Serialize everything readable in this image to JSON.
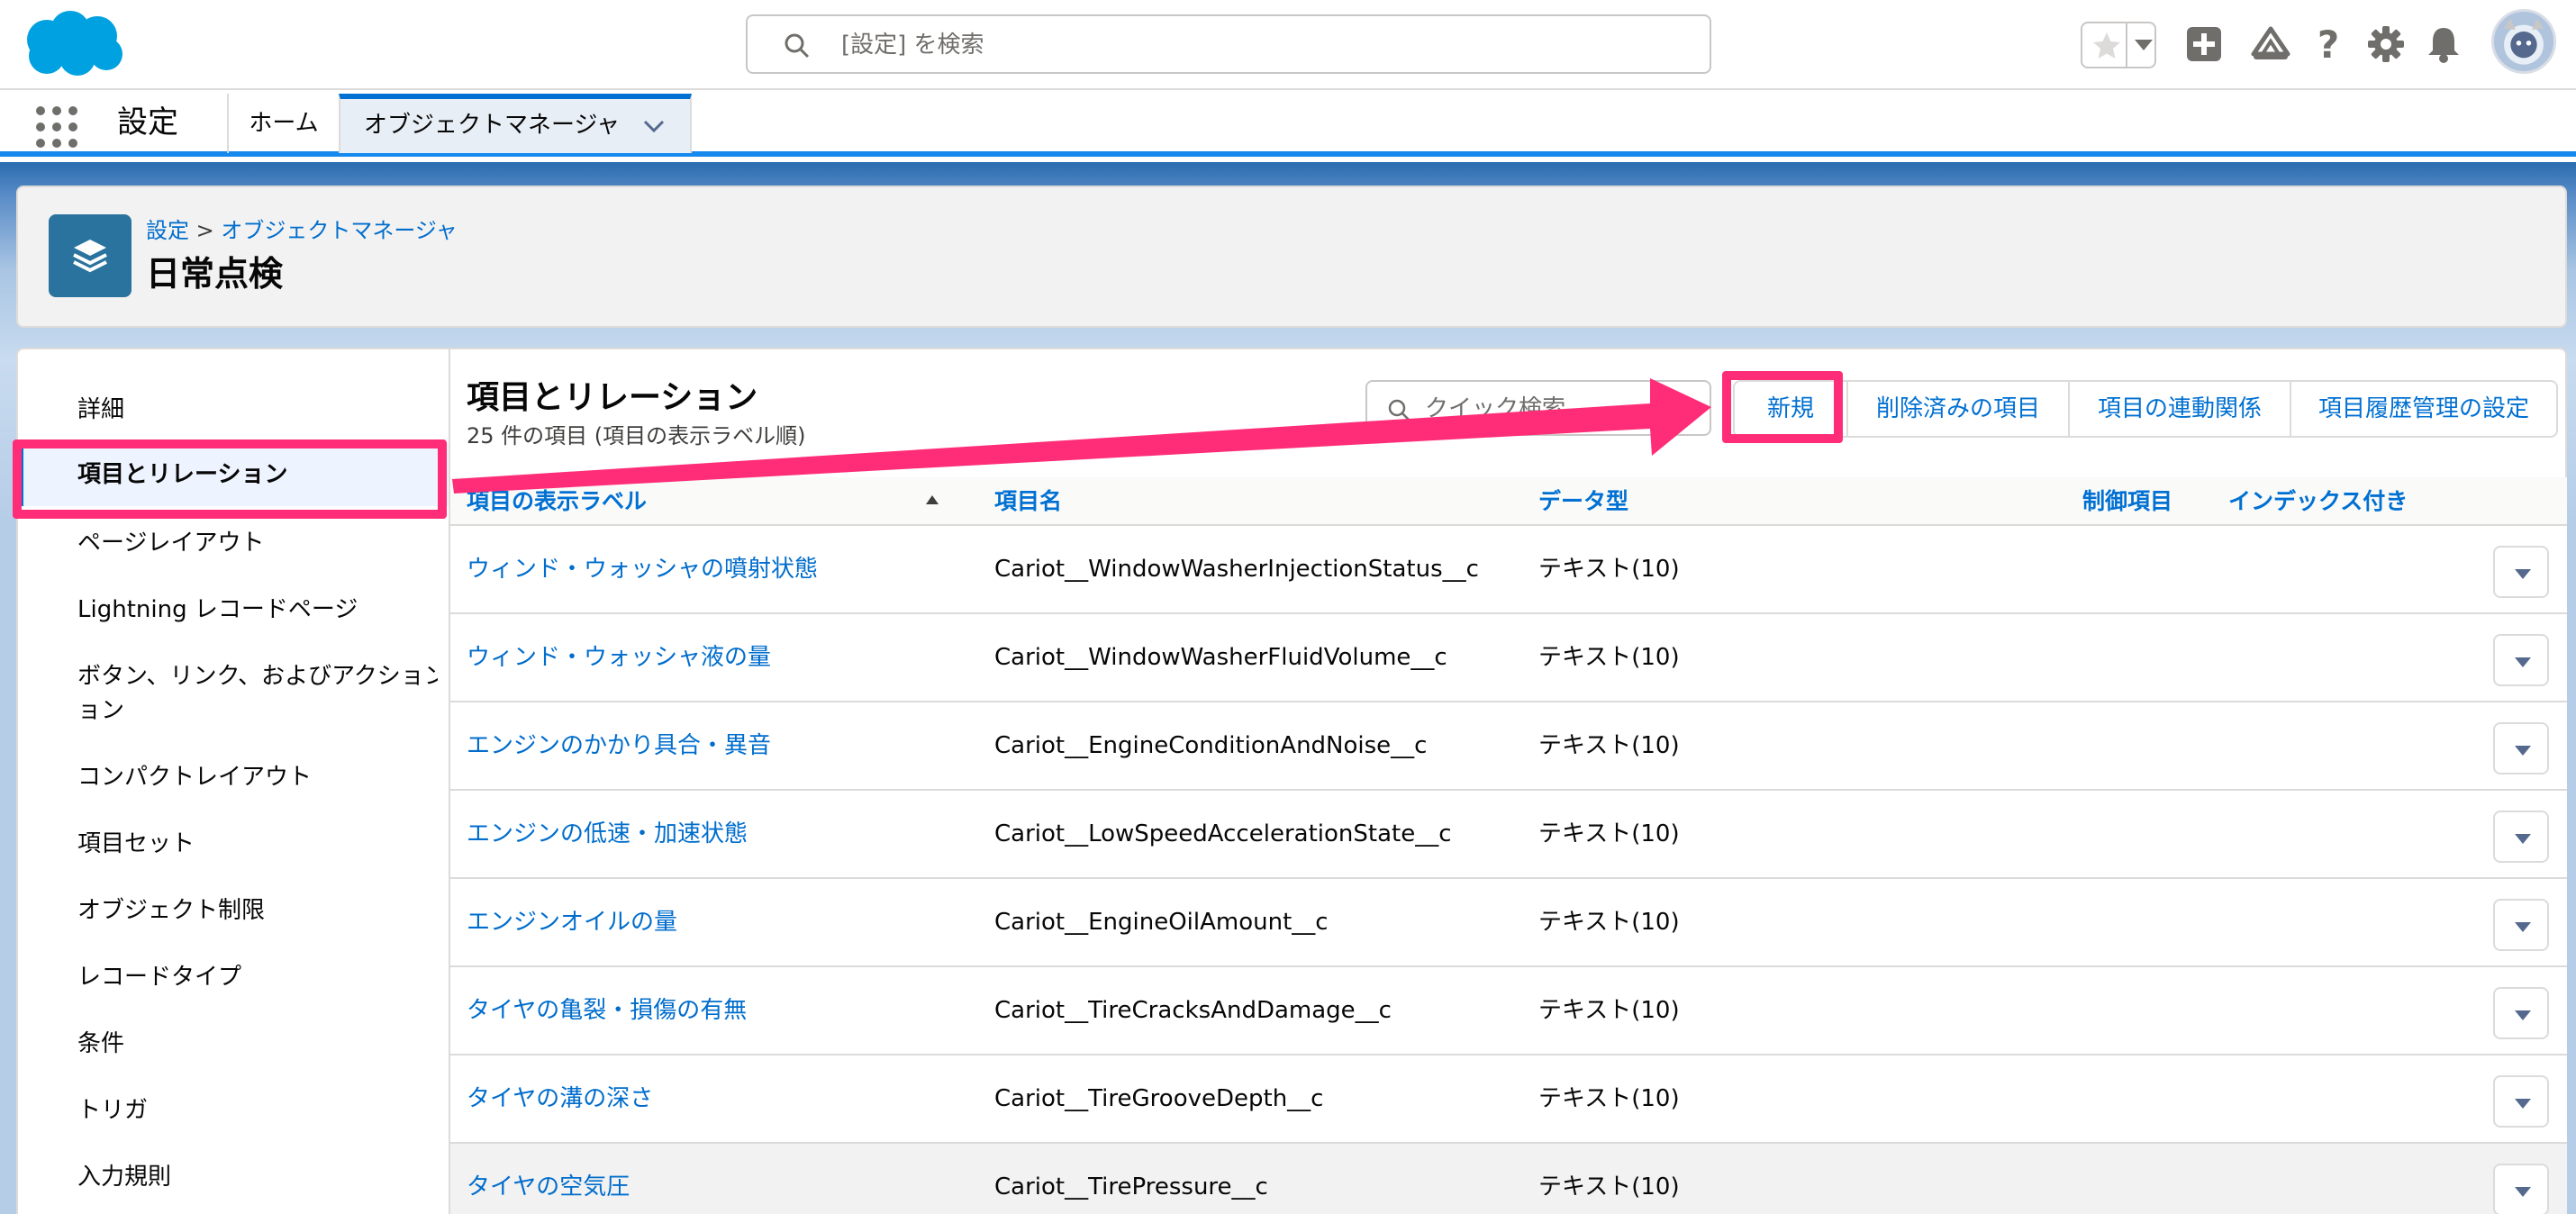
{
  "global_header": {
    "search_placeholder": "[設定] を検索",
    "icons": [
      "favorites-star-icon",
      "chevron-down-icon",
      "add-icon",
      "trailhead-icon",
      "help-icon",
      "gear-icon",
      "bell-icon",
      "avatar"
    ]
  },
  "context_bar": {
    "app_name": "設定",
    "tabs": [
      {
        "label": "ホーム"
      },
      {
        "label": "オブジェクトマネージャ"
      }
    ]
  },
  "page_header": {
    "breadcrumb_root": "設定",
    "breadcrumb_sep": ">",
    "breadcrumb_child": "オブジェクトマネージャ",
    "title": "日常点検"
  },
  "sidebar": {
    "items": [
      {
        "label": "詳細"
      },
      {
        "label": "項目とリレーション"
      },
      {
        "label": "ページレイアウト"
      },
      {
        "label": "Lightning レコードページ"
      },
      {
        "label": "ボタン、リンク、およびアクション",
        "label_line2": "ョン"
      },
      {
        "label": "コンパクトレイアウト"
      },
      {
        "label": "項目セット"
      },
      {
        "label": "オブジェクト制限"
      },
      {
        "label": "レコードタイプ"
      },
      {
        "label": "条件"
      },
      {
        "label": "トリガ"
      },
      {
        "label": "入力規則"
      }
    ]
  },
  "section": {
    "title": "項目とリレーション",
    "subtitle": "25 件の項目 (項目の表示ラベル順)",
    "quick_find_placeholder": "クイック検索",
    "buttons": [
      "新規",
      "削除済みの項目",
      "項目の連動関係",
      "項目履歴管理の設定"
    ]
  },
  "table": {
    "headers": [
      "項目の表示ラベル",
      "項目名",
      "データ型",
      "制御項目",
      "インデックス付き"
    ],
    "rows": [
      {
        "label": "ウィンド・ウォッシャの噴射状態",
        "api": "Cariot__WindowWasherInjectionStatus__c",
        "type": "テキスト(10)"
      },
      {
        "label": "ウィンド・ウォッシャ液の量",
        "api": "Cariot__WindowWasherFluidVolume__c",
        "type": "テキスト(10)"
      },
      {
        "label": "エンジンのかかり具合・異音",
        "api": "Cariot__EngineConditionAndNoise__c",
        "type": "テキスト(10)"
      },
      {
        "label": "エンジンの低速・加速状態",
        "api": "Cariot__LowSpeedAccelerationState__c",
        "type": "テキスト(10)"
      },
      {
        "label": "エンジンオイルの量",
        "api": "Cariot__EngineOilAmount__c",
        "type": "テキスト(10)"
      },
      {
        "label": "タイヤの亀裂・損傷の有無",
        "api": "Cariot__TireCracksAndDamage__c",
        "type": "テキスト(10)"
      },
      {
        "label": "タイヤの溝の深さ",
        "api": "Cariot__TireGrooveDepth__c",
        "type": "テキスト(10)"
      },
      {
        "label": "タイヤの空気圧",
        "api": "Cariot__TirePressure__c",
        "type": "テキスト(10)"
      }
    ]
  },
  "colors": {
    "brand": "#1589ee",
    "link": "#006dcc",
    "annotation": "#ff2d78",
    "object_icon": "#2a739e"
  }
}
